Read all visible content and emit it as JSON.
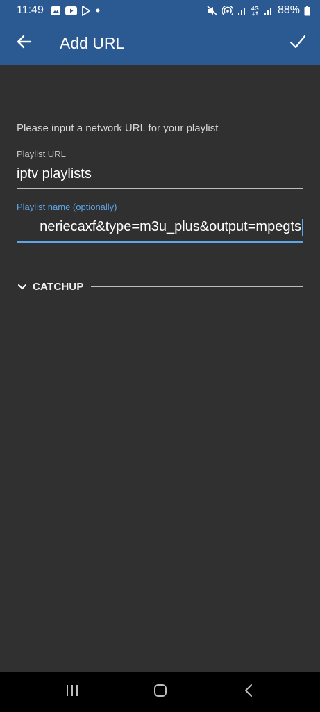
{
  "status_bar": {
    "time": "11:49",
    "battery": "88%",
    "network_label": "4G"
  },
  "app_bar": {
    "title": "Add URL"
  },
  "form": {
    "instruction": "Please input a network URL for your playlist",
    "playlist_url": {
      "label": "Playlist URL",
      "value": "iptv playlists"
    },
    "playlist_name": {
      "label": "Playlist name (optionally)",
      "value": "neriecaxf&type=m3u_plus&output=mpegts"
    },
    "catchup": {
      "label": "CATCHUP"
    }
  },
  "colors": {
    "app_bar": "#2b5a93",
    "background": "#303030",
    "accent": "#5ea6ea"
  }
}
